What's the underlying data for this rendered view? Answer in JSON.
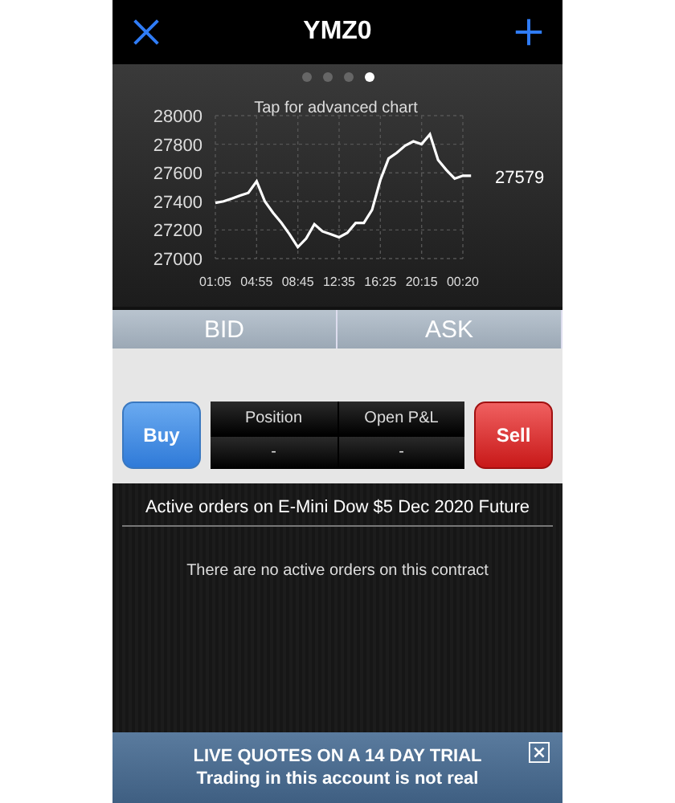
{
  "header": {
    "title": "YMZ0"
  },
  "pages": [
    {
      "selected": false
    },
    {
      "selected": false
    },
    {
      "selected": false
    },
    {
      "selected": true
    }
  ],
  "chart": {
    "hint": "Tap for advanced chart",
    "last_price": "27579",
    "chart_data": {
      "type": "line",
      "categories": [
        "01:05",
        null,
        null,
        null,
        null,
        "04:55",
        null,
        null,
        null,
        null,
        "08:45",
        null,
        null,
        null,
        null,
        "12:35",
        null,
        null,
        null,
        null,
        "16:25",
        null,
        null,
        null,
        null,
        "20:15",
        null,
        null,
        null,
        null,
        "00:20",
        null
      ],
      "series": [
        {
          "color": "#ffffff",
          "values": [
            27390,
            27400,
            27420,
            27440,
            27460,
            27540,
            27400,
            27320,
            27250,
            27170,
            27080,
            27140,
            27240,
            27190,
            27170,
            27150,
            27180,
            27250,
            27250,
            27340,
            27550,
            27700,
            27740,
            27790,
            27820,
            27800,
            27870,
            27690,
            27620,
            27560,
            27580,
            27580
          ]
        }
      ],
      "ylim": [
        27000,
        28000
      ],
      "grid": true,
      "yticks": [
        27000,
        27200,
        27400,
        27600,
        27800,
        28000
      ]
    }
  },
  "quote": {
    "bid_label": "BID",
    "ask_label": "ASK"
  },
  "trade": {
    "buy": "Buy",
    "sell": "Sell",
    "position_label": "Position",
    "position_value": "-",
    "pnl_label": "Open P&L",
    "pnl_value": "-"
  },
  "orders": {
    "heading": "Active orders on E-Mini Dow $5 Dec 2020 Future",
    "empty": "There are no active orders on this contract"
  },
  "banner": {
    "title": "LIVE QUOTES ON A 14 DAY TRIAL",
    "subtitle": "Trading in this account is not real"
  }
}
